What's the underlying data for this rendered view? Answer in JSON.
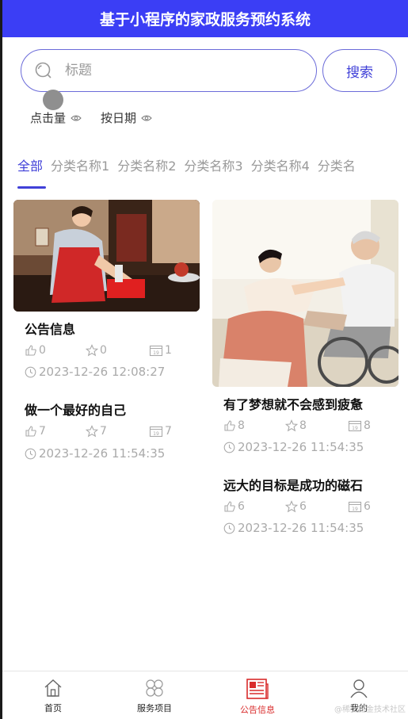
{
  "header": {
    "title": "基于小程序的家政服务预约系统"
  },
  "search": {
    "placeholder": "标题",
    "button_label": "搜索"
  },
  "sort": {
    "by_clicks": "点击量",
    "by_date": "按日期"
  },
  "categories": [
    "全部",
    "分类名称1",
    "分类名称2",
    "分类名称3",
    "分类名称4",
    "分类名"
  ],
  "active_category_index": 0,
  "cards": [
    {
      "title": "公告信息",
      "likes": "0",
      "favorites": "0",
      "views": "1",
      "date": "2023-12-26 12:08:27"
    },
    {
      "title": "有了梦想就不会感到疲惫",
      "likes": "8",
      "favorites": "8",
      "views": "8",
      "date": "2023-12-26 11:54:35"
    },
    {
      "title": "做一个最好的自己",
      "likes": "7",
      "favorites": "7",
      "views": "7",
      "date": "2023-12-26 11:54:35"
    },
    {
      "title": "远大的目标是成功的磁石",
      "likes": "6",
      "favorites": "6",
      "views": "6",
      "date": "2023-12-26 11:54:35"
    }
  ],
  "tabbar": {
    "items": [
      {
        "label": "首页",
        "icon": "home-icon"
      },
      {
        "label": "服务项目",
        "icon": "grid-icon"
      },
      {
        "label": "公告信息",
        "icon": "newspaper-icon"
      },
      {
        "label": "我的",
        "icon": "user-icon"
      }
    ],
    "active_index": 2
  },
  "watermark": "@稀土掘金技术社区",
  "colors": {
    "accent": "#3b3ef5",
    "active_tab": "#d92b2b",
    "muted": "#aaaaaa"
  }
}
